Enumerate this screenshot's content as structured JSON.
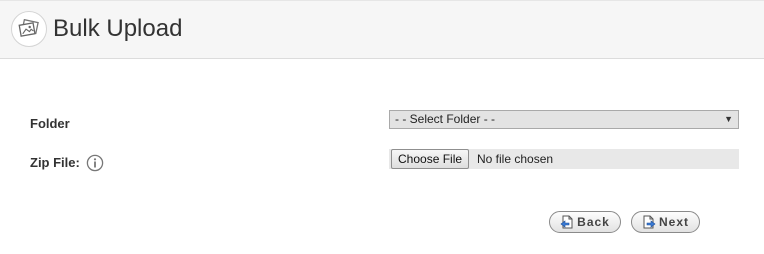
{
  "header": {
    "title": "Bulk Upload",
    "icon": "images-icon"
  },
  "form": {
    "folder_label": "Folder",
    "folder_select": {
      "selected": "- - Select Folder - -"
    },
    "zip_label": "Zip File:",
    "zip_info_icon": "info-icon",
    "file_input": {
      "button_label": "Choose File",
      "status": "No file chosen"
    }
  },
  "actions": {
    "back_label": "Back",
    "next_label": "Next"
  },
  "colors": {
    "header_bg": "#f6f6f6",
    "text": "#333333",
    "select_bg": "#e3e3e3"
  }
}
